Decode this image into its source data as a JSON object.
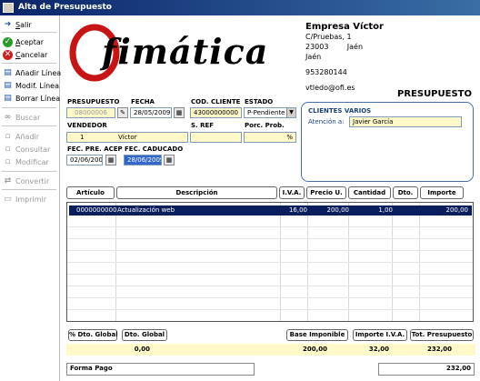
{
  "window": {
    "title": "Alta de Presupuesto"
  },
  "sidebar": {
    "items": [
      {
        "label_u": "S",
        "label_rest": "alir",
        "icon": "exit-icon",
        "enabled": true
      },
      {
        "label_u": "A",
        "label_rest": "ceptar",
        "icon": "check-icon",
        "enabled": true
      },
      {
        "label_u": "C",
        "label_rest": "ancelar",
        "icon": "cancel-icon",
        "enabled": true
      },
      {
        "label": "Añadir Línea",
        "icon": "add-line-icon",
        "enabled": true
      },
      {
        "label": "Modif. Línea",
        "icon": "edit-line-icon",
        "enabled": true
      },
      {
        "label": "Borrar Línea",
        "icon": "delete-line-icon",
        "enabled": true
      },
      {
        "label": "Buscar",
        "icon": "binoculars-icon",
        "enabled": false
      },
      {
        "label": "Añadir",
        "icon": "add-icon",
        "enabled": false
      },
      {
        "label": "Consultar",
        "icon": "consult-icon",
        "enabled": false
      },
      {
        "label": "Modificar",
        "icon": "modify-icon",
        "enabled": false
      },
      {
        "label": "Convertir",
        "icon": "convert-icon",
        "enabled": false
      },
      {
        "label": "Imprimir",
        "icon": "printer-icon",
        "enabled": false
      }
    ]
  },
  "logo": {
    "text": "fimática"
  },
  "company": {
    "name": "Empresa Víctor",
    "street": "C/Pruebas, 1",
    "zip_city": "23003        Jaén",
    "province": "Jaén",
    "phone": "953280144",
    "email": "vtledo@ofi.es"
  },
  "document_title": "PRESUPUESTO",
  "form": {
    "presupuesto_label": "PRESUPUESTO",
    "presupuesto_value": "08000006",
    "fecha_label": "FECHA",
    "fecha_value": "28/05/2009",
    "cod_cliente_label": "COD. CLIENTE",
    "cod_cliente_value": "43000000000",
    "estado_label": "ESTADO",
    "estado_value": "P-Pendiente",
    "vendedor_label": "VENDEDOR",
    "vendedor_code": "1",
    "vendedor_name": "Víctor",
    "sref_label": "S. REF",
    "sref_value": "",
    "porc_label": "Porc. Prob.",
    "porc_unit": "%",
    "fec_pre_acep_label": "FEC. PRE. ACEP",
    "fec_pre_acep_value": "02/06/2009",
    "fec_caducado_label": "FEC. CADUCADO",
    "fec_caducado_value": "28/06/2009"
  },
  "client": {
    "name": "CLIENTES VARIOS",
    "atencion_label": "Atención a:",
    "atencion_value": "Javier García"
  },
  "grid": {
    "columns": [
      "Artículo",
      "Descripción",
      "I.V.A.",
      "Precio U.",
      "Cantidad",
      "Dto.",
      "Importe"
    ],
    "rows": [
      {
        "articulo": "0000000000",
        "descripcion": "Actualización web",
        "iva": "16,00",
        "precio": "200,00",
        "cantidad": "1,00",
        "dto": "",
        "importe": "200,00"
      }
    ]
  },
  "totals": {
    "headers": [
      "% Dto. Global",
      "Dto. Global",
      "Base Imponible",
      "Importe I.V.A.",
      "Tot. Presupuesto"
    ],
    "dto_global": "0,00",
    "base_imponible": "200,00",
    "importe_iva": "32,00",
    "tot_presupuesto": "232,00",
    "forma_pago_label": "Forma Pago",
    "forma_pago_value": "",
    "grand_total": "232,00"
  }
}
